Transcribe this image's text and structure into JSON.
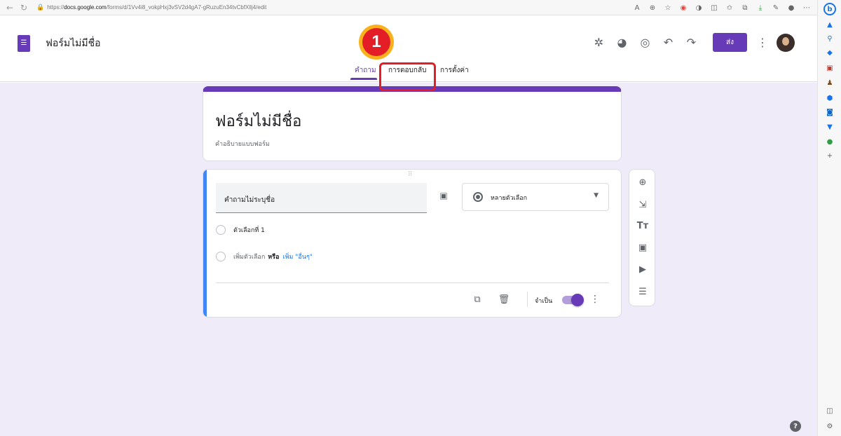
{
  "browser": {
    "url_prefix": "https://",
    "url_domain": "docs.google.com",
    "url_path": "/forms/d/1Vv4i8_vokpHxj3vSV2d4gA7-gRuzuEn34tvCbfXllj4/edit"
  },
  "header": {
    "doc_title": "ฟอร์มไม่มีชื่อ",
    "send_label": "ส่ง"
  },
  "tabs": [
    {
      "label": "คำถาม",
      "active": true
    },
    {
      "label": "การตอบกลับ",
      "active": false
    },
    {
      "label": "การตั้งค่า",
      "active": false
    }
  ],
  "annotation": {
    "step_number": "1",
    "highlight_color": "#e41e26",
    "badge_color": "#f9b21c"
  },
  "form": {
    "title": "ฟอร์มไม่มีชื่อ",
    "description": "คำอธิบายแบบฟอร์ม"
  },
  "question": {
    "text": "คำถามไม่ระบุชื่อ",
    "type_label": "หลายตัวเลือก",
    "options": [
      "ตัวเลือกที่ 1"
    ],
    "add_option_label": "เพิ่มตัวเลือก",
    "or_label": "หรือ",
    "add_other_label": "เพิ่ม \"อื่นๆ\"",
    "required_label": "จำเป็น",
    "required": true
  },
  "colors": {
    "accent": "#673ab7",
    "canvas_bg": "#f0ebf8",
    "question_accent": "#4285f4"
  },
  "icons": {
    "toolbar": [
      "add-question-icon",
      "import-questions-icon",
      "add-title-icon",
      "add-image-icon",
      "add-video-icon",
      "add-section-icon"
    ],
    "header": [
      "addons-icon",
      "palette-icon",
      "preview-icon",
      "undo-icon",
      "redo-icon"
    ]
  }
}
